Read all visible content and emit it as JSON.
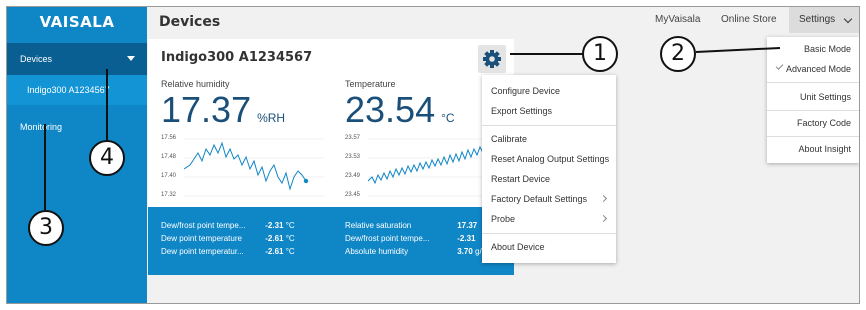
{
  "app": {
    "logo": "VAISALA",
    "page_title": "Devices"
  },
  "sidebar": {
    "items": [
      {
        "label": "Devices"
      },
      {
        "label": "Indigo300 A1234567"
      },
      {
        "label": "Monitoring"
      }
    ]
  },
  "topbar": {
    "links": [
      "MyVaisala",
      "Online Store"
    ],
    "settings_label": "Settings"
  },
  "device_card": {
    "title": "Indigo300 A1234567",
    "measurements": [
      {
        "label": "Relative humidity",
        "value": "17.37",
        "unit": "%RH",
        "yticks": [
          "17.56",
          "17.48",
          "17.40",
          "17.32"
        ]
      },
      {
        "label": "Temperature",
        "value": "23.54",
        "unit": "°C",
        "yticks": [
          "23.57",
          "23.53",
          "23.49",
          "23.45"
        ]
      }
    ],
    "summary": [
      {
        "label": "Dew/frost point tempe...",
        "value": "-2.31",
        "unit": "°C"
      },
      {
        "label": "Dew point temperature",
        "value": "-2.61",
        "unit": "°C"
      },
      {
        "label": "Dew point temperatur...",
        "value": "-2.61",
        "unit": "°C"
      },
      {
        "label": "Relative saturation",
        "value": "17.37",
        "unit": ""
      },
      {
        "label": "Dew/frost point tempe...",
        "value": "-2.31",
        "unit": ""
      },
      {
        "label": "Absolute humidity",
        "value": "3.70",
        "unit": "g/m³"
      }
    ]
  },
  "device_menu": {
    "items": [
      {
        "label": "Configure Device"
      },
      {
        "label": "Export Settings"
      },
      {
        "label": "Calibrate"
      },
      {
        "label": "Reset Analog Output Settings"
      },
      {
        "label": "Restart Device"
      },
      {
        "label": "Factory Default Settings"
      },
      {
        "label": "Probe"
      },
      {
        "label": "About Device"
      }
    ]
  },
  "settings_menu": {
    "items": [
      {
        "label": "Basic Mode"
      },
      {
        "label": "Advanced Mode"
      },
      {
        "label": "Unit Settings"
      },
      {
        "label": "Factory Code"
      },
      {
        "label": "About Insight"
      }
    ]
  },
  "callouts": [
    "1",
    "2",
    "3",
    "4"
  ],
  "colors": {
    "sidebar": "#0f86c6",
    "sidebar_active": "#0a5f92",
    "value_text": "#1a4f7a",
    "summary_bg": "#0f86c6"
  },
  "icons": [
    "gear-icon",
    "caret-down-icon",
    "chevron-down-icon",
    "checkmark-icon",
    "chevron-right-icon"
  ]
}
